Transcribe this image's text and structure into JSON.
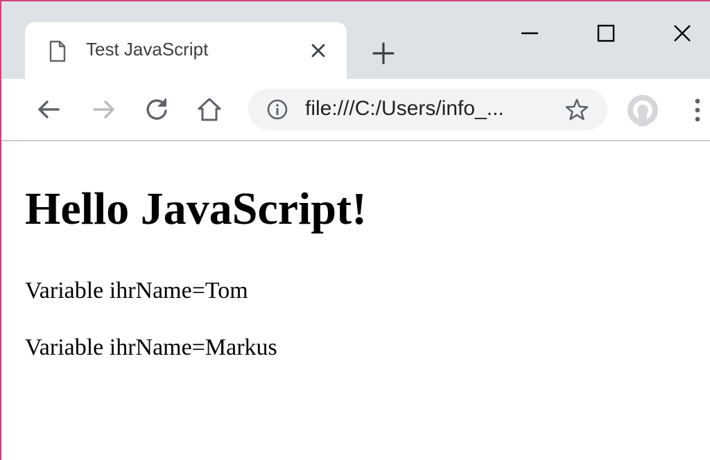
{
  "browser": {
    "tab": {
      "title": "Test JavaScript",
      "icon": "document-icon"
    },
    "address_bar": {
      "url": "file:///C:/Users/info_..."
    },
    "icons": {
      "back": "arrow-left-icon",
      "forward": "arrow-right-icon",
      "reload": "reload-icon",
      "home": "home-icon",
      "info": "info-icon",
      "bookmark": "star-icon",
      "profile": "avatar",
      "menu": "kebab-menu-icon",
      "new_tab": "plus-icon",
      "minimize": "minimize-icon",
      "maximize": "maximize-icon",
      "close": "close-icon"
    },
    "colors": {
      "titlebar": "#dee1e6",
      "tab": "#ffffff",
      "omnibox": "#f1f3f4",
      "icon": "#5f6368",
      "icon_disabled": "#babcbe",
      "window_border": "#d0407a"
    }
  },
  "page": {
    "heading": "Hello JavaScript!",
    "paragraphs": [
      "Variable ihrName=Tom",
      "Variable ihrName=Markus"
    ]
  }
}
